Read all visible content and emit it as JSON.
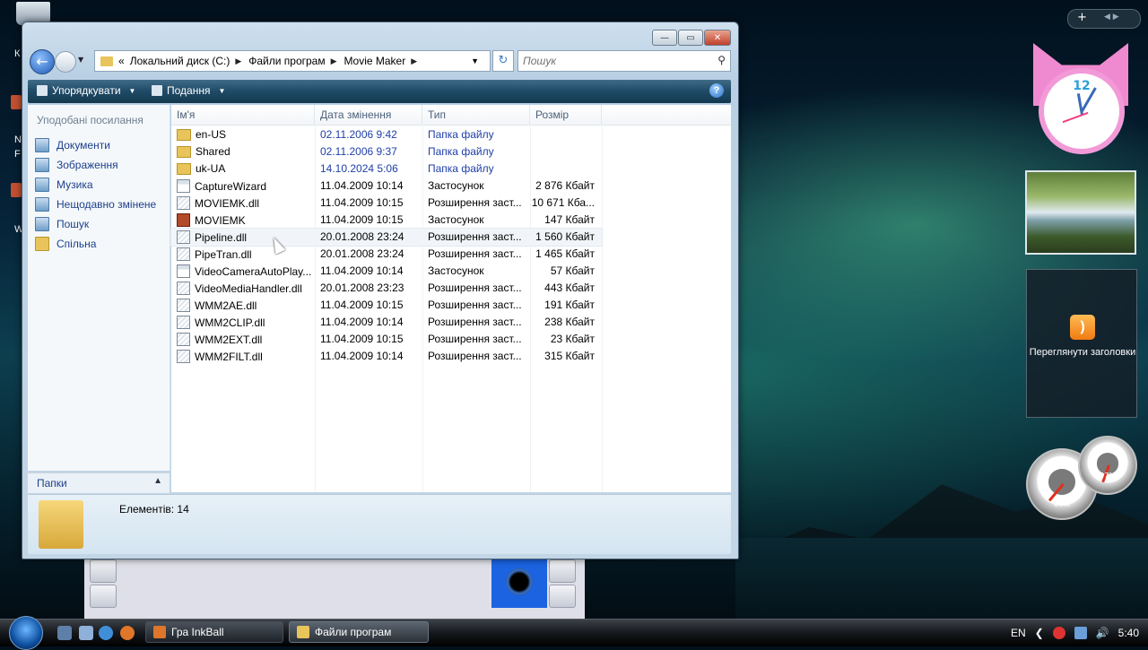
{
  "desktop": {
    "left_edge_text": [
      "К",
      "N",
      "F",
      "W"
    ]
  },
  "window": {
    "controls": {
      "minimize": "—",
      "maximize": "▭",
      "close": "✕"
    },
    "address": {
      "overflow": "«",
      "parts": [
        "Локальний диск (C:)",
        "Файли програм",
        "Movie Maker"
      ]
    },
    "search_placeholder": "Пошук",
    "toolbar": {
      "organize": "Упорядкувати",
      "views": "Подання",
      "help": "?"
    },
    "favorites": {
      "title": "Уподобані посилання",
      "items": [
        {
          "label": "Документи",
          "icon": "documents-icon"
        },
        {
          "label": "Зображення",
          "icon": "pictures-icon"
        },
        {
          "label": "Музика",
          "icon": "music-icon"
        },
        {
          "label": "Нещодавно змінене",
          "icon": "recent-icon"
        },
        {
          "label": "Пошук",
          "icon": "search-folder-icon"
        },
        {
          "label": "Спільна",
          "icon": "public-folder-icon"
        }
      ]
    },
    "folders_label": "Папки",
    "columns": {
      "name": "Ім'я",
      "date": "Дата змінення",
      "type": "Тип",
      "size": "Розмір"
    },
    "files": [
      {
        "name": "en-US",
        "date": "02.11.2006 9:42",
        "type": "Папка файлу",
        "size": "",
        "icon": "folder"
      },
      {
        "name": "Shared",
        "date": "02.11.2006 9:37",
        "type": "Папка файлу",
        "size": "",
        "icon": "folder"
      },
      {
        "name": "uk-UA",
        "date": "14.10.2024 5:06",
        "type": "Папка файлу",
        "size": "",
        "icon": "folder"
      },
      {
        "name": "CaptureWizard",
        "date": "11.04.2009 10:14",
        "type": "Застосунок",
        "size": "2 876 Кбайт",
        "icon": "app"
      },
      {
        "name": "MOVIEMK.dll",
        "date": "11.04.2009 10:15",
        "type": "Розширення заст...",
        "size": "10 671 Кба...",
        "icon": "dll"
      },
      {
        "name": "MOVIEMK",
        "date": "11.04.2009 10:15",
        "type": "Застосунок",
        "size": "147 Кбайт",
        "icon": "mm"
      },
      {
        "name": "Pipeline.dll",
        "date": "20.01.2008 23:24",
        "type": "Розширення заст...",
        "size": "1 560 Кбайт",
        "icon": "dll"
      },
      {
        "name": "PipeTran.dll",
        "date": "20.01.2008 23:24",
        "type": "Розширення заст...",
        "size": "1 465 Кбайт",
        "icon": "dll"
      },
      {
        "name": "VideoCameraAutoPlay...",
        "date": "11.04.2009 10:14",
        "type": "Застосунок",
        "size": "57 Кбайт",
        "icon": "app"
      },
      {
        "name": "VideoMediaHandler.dll",
        "date": "20.01.2008 23:23",
        "type": "Розширення заст...",
        "size": "443 Кбайт",
        "icon": "dll"
      },
      {
        "name": "WMM2AE.dll",
        "date": "11.04.2009 10:15",
        "type": "Розширення заст...",
        "size": "191 Кбайт",
        "icon": "dll"
      },
      {
        "name": "WMM2CLIP.dll",
        "date": "11.04.2009 10:14",
        "type": "Розширення заст...",
        "size": "238 Кбайт",
        "icon": "dll"
      },
      {
        "name": "WMM2EXT.dll",
        "date": "11.04.2009 10:15",
        "type": "Розширення заст...",
        "size": "23 Кбайт",
        "icon": "dll"
      },
      {
        "name": "WMM2FILT.dll",
        "date": "11.04.2009 10:14",
        "type": "Розширення заст...",
        "size": "315 Кбайт",
        "icon": "dll"
      }
    ],
    "details": {
      "count": "Елементів: 14"
    }
  },
  "taskbar": {
    "tasks": [
      {
        "label": "Гра InkBall",
        "active": false
      },
      {
        "label": "Файли програм",
        "active": true
      }
    ],
    "lang": "EN",
    "time": "5:40"
  },
  "gadgets": {
    "sidebar_controls": {
      "add": "+",
      "nav": "◀  ▶"
    },
    "clock_number": "12",
    "feeds_label": "Переглянути заголовки",
    "cpu_meter": "07%",
    "mem_meter": "37%"
  },
  "colors": {
    "accent": "#1f3fa8",
    "toolbar": "#1f4a66"
  }
}
